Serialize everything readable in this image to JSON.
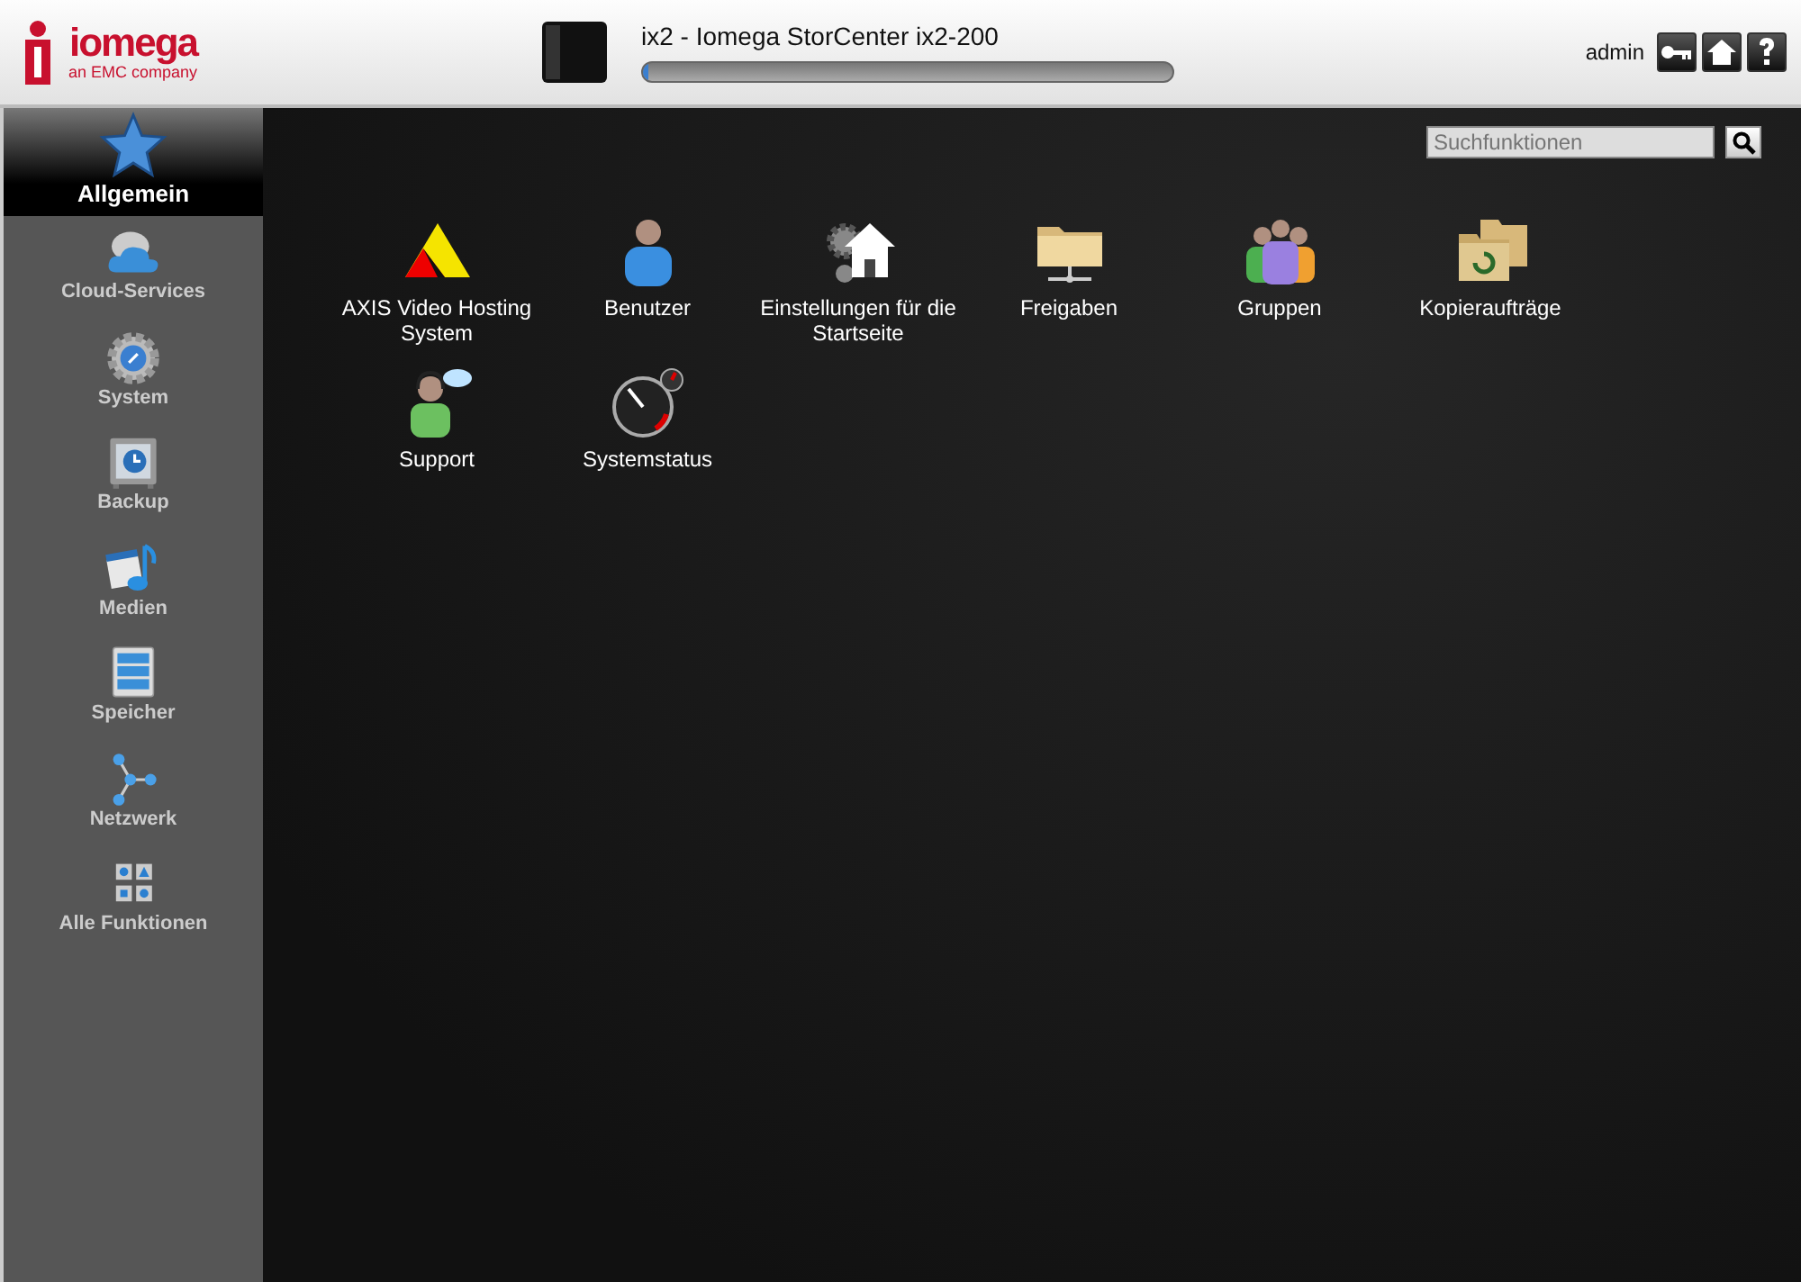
{
  "header": {
    "brand": "iomega",
    "brand_sub": "an EMC company",
    "device_title": "ix2 - Iomega StorCenter ix2-200",
    "capacity": {
      "level": 0.01
    },
    "user": "admin"
  },
  "sidebar": {
    "items": [
      {
        "label": "Allgemein",
        "kind": "star",
        "selected": true
      },
      {
        "label": "Cloud-Services",
        "kind": "cloud",
        "selected": false
      },
      {
        "label": "System",
        "kind": "gear",
        "selected": false
      },
      {
        "label": "Backup",
        "kind": "safe",
        "selected": false
      },
      {
        "label": "Medien",
        "kind": "media",
        "selected": false
      },
      {
        "label": "Speicher",
        "kind": "storage",
        "selected": false
      },
      {
        "label": "Netzwerk",
        "kind": "network",
        "selected": false
      },
      {
        "label": "Alle Funktionen",
        "kind": "grid",
        "selected": false
      }
    ]
  },
  "search": {
    "placeholder": "Suchfunktionen"
  },
  "features": [
    {
      "label": "AXIS Video Hosting System",
      "kind": "axis"
    },
    {
      "label": "Benutzer",
      "kind": "user"
    },
    {
      "label": "Einstellungen für die Startseite",
      "kind": "homegear"
    },
    {
      "label": "Freigaben",
      "kind": "share"
    },
    {
      "label": "Gruppen",
      "kind": "group"
    },
    {
      "label": "Kopieraufträge",
      "kind": "copy"
    },
    {
      "label": "Support",
      "kind": "support"
    },
    {
      "label": "Systemstatus",
      "kind": "gauge"
    }
  ]
}
